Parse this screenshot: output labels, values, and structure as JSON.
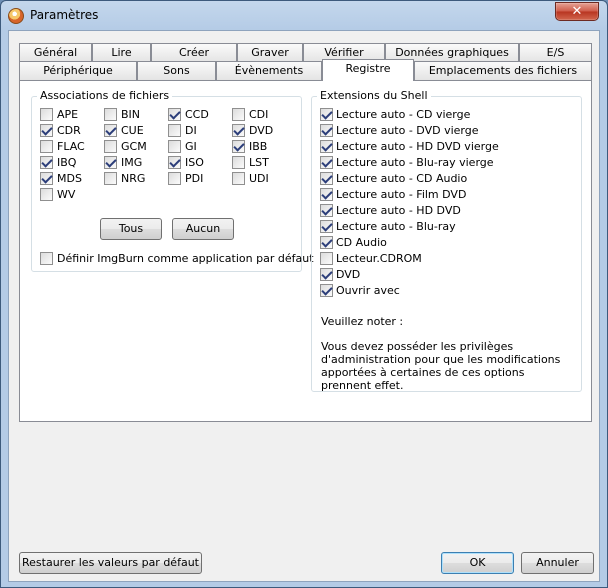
{
  "window": {
    "title": "Paramètres",
    "close_symbol": "✕"
  },
  "tabs_row1": [
    {
      "label": "Général"
    },
    {
      "label": "Lire"
    },
    {
      "label": "Créer"
    },
    {
      "label": "Graver"
    },
    {
      "label": "Vérifier"
    },
    {
      "label": "Données graphiques"
    },
    {
      "label": "E/S"
    }
  ],
  "tabs_row2": [
    {
      "label": "Périphérique"
    },
    {
      "label": "Sons"
    },
    {
      "label": "Évènements"
    },
    {
      "label": "Registre",
      "active": true
    },
    {
      "label": "Emplacements des fichiers"
    }
  ],
  "file_assoc": {
    "title": "Associations de fichiers",
    "items": [
      {
        "label": "APE",
        "checked": false
      },
      {
        "label": "BIN",
        "checked": false
      },
      {
        "label": "CCD",
        "checked": true
      },
      {
        "label": "CDI",
        "checked": false
      },
      {
        "label": "CDR",
        "checked": true
      },
      {
        "label": "CUE",
        "checked": true
      },
      {
        "label": "DI",
        "checked": false
      },
      {
        "label": "DVD",
        "checked": true
      },
      {
        "label": "FLAC",
        "checked": false
      },
      {
        "label": "GCM",
        "checked": false
      },
      {
        "label": "GI",
        "checked": false
      },
      {
        "label": "IBB",
        "checked": true
      },
      {
        "label": "IBQ",
        "checked": true
      },
      {
        "label": "IMG",
        "checked": true
      },
      {
        "label": "ISO",
        "checked": true
      },
      {
        "label": "LST",
        "checked": false
      },
      {
        "label": "MDS",
        "checked": true
      },
      {
        "label": "NRG",
        "checked": false
      },
      {
        "label": "PDI",
        "checked": false
      },
      {
        "label": "UDI",
        "checked": false
      },
      {
        "label": "WV",
        "checked": false
      }
    ],
    "all_button": "Tous",
    "none_button": "Aucun",
    "default_app_label": "Définir ImgBurn comme application par défaut",
    "default_app_checked": false
  },
  "shell": {
    "title": "Extensions du Shell",
    "items": [
      {
        "label": "Lecture auto - CD vierge",
        "checked": true
      },
      {
        "label": "Lecture auto - DVD vierge",
        "checked": true
      },
      {
        "label": "Lecture auto - HD DVD vierge",
        "checked": true
      },
      {
        "label": "Lecture auto - Blu-ray vierge",
        "checked": true
      },
      {
        "label": "Lecture auto - CD Audio",
        "checked": true
      },
      {
        "label": "Lecture auto - Film DVD",
        "checked": true
      },
      {
        "label": "Lecture auto - HD DVD",
        "checked": true
      },
      {
        "label": "Lecture auto - Blu-ray",
        "checked": true
      },
      {
        "label": "CD Audio",
        "checked": true
      },
      {
        "label": "Lecteur.CDROM",
        "checked": false
      },
      {
        "label": "DVD",
        "checked": true
      },
      {
        "label": "Ouvrir avec",
        "checked": true
      }
    ],
    "note_title": "Veuillez noter :",
    "note_body": "Vous devez posséder les privilèges d'administration pour que les modifications apportées à certaines de ces options prennent effet."
  },
  "footer": {
    "restore_button": "Restaurer les valeurs par défaut",
    "ok_button": "OK",
    "cancel_button": "Annuler"
  }
}
